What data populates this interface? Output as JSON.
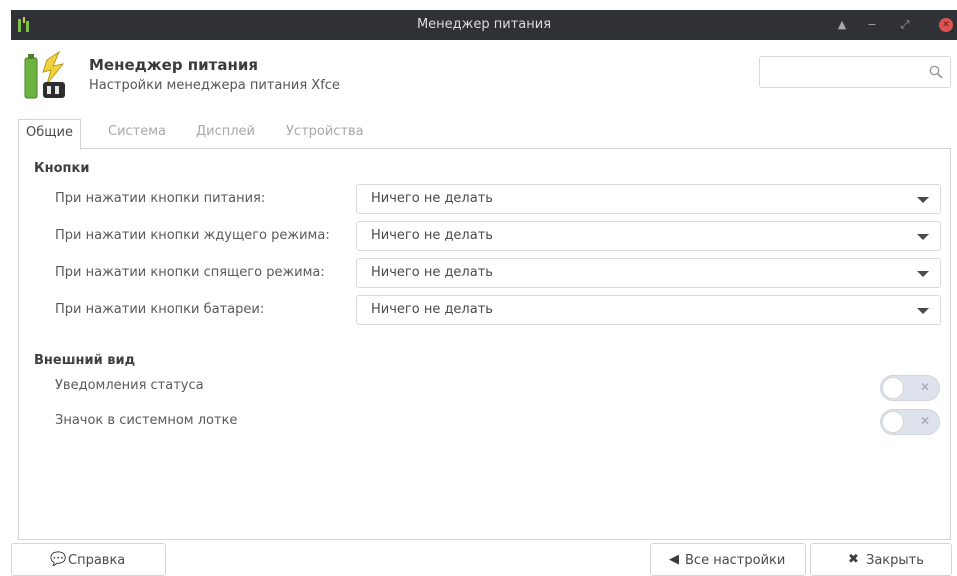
{
  "window": {
    "title": "Менеджер питания",
    "controls": [
      "minimize-up",
      "minimize",
      "maximize",
      "close"
    ]
  },
  "header": {
    "title": "Менеджер питания",
    "subtitle": "Настройки менеджера питания Xfce",
    "search": {
      "value": "",
      "placeholder": ""
    }
  },
  "tabs": [
    {
      "label": "Общие",
      "active": true
    },
    {
      "label": "Система",
      "active": false
    },
    {
      "label": "Дисплей",
      "active": false
    },
    {
      "label": "Устройства",
      "active": false
    }
  ],
  "buttons_section": {
    "title": "Кнопки",
    "rows": [
      {
        "label": "При нажатии кнопки питания:",
        "value": "Ничего не делать"
      },
      {
        "label": "При нажатии кнопки ждущего режима:",
        "value": "Ничего не делать"
      },
      {
        "label": "При нажатии кнопки спящего режима:",
        "value": "Ничего не делать"
      },
      {
        "label": "При нажатии кнопки батареи:",
        "value": "Ничего не делать"
      }
    ]
  },
  "appearance_section": {
    "title": "Внешний вид",
    "rows": [
      {
        "label": "Уведомления статуса",
        "enabled": false
      },
      {
        "label": "Значок в системном лотке",
        "enabled": false
      }
    ]
  },
  "footer": {
    "help_label": "Справка",
    "all_settings_label": "Все настройки",
    "close_label": "Закрыть"
  },
  "colors": {
    "titlebar": "#2f3136",
    "close_button": "#d9534f",
    "toggle_track": "#dde2ec"
  }
}
